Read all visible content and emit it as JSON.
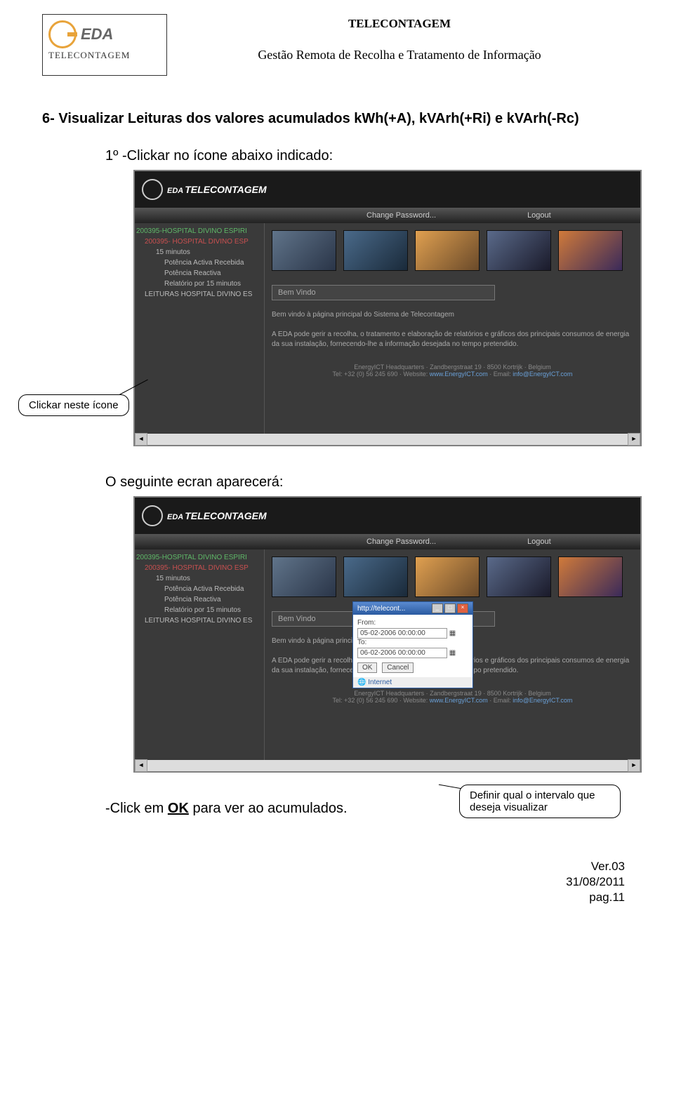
{
  "header": {
    "brand_name": "EDA",
    "brand_sub": "TELECONTAGEM",
    "line1": "TELECONTAGEM",
    "line2": "Gestão Remota de Recolha e Tratamento de Informação"
  },
  "section_title": "6- Visualizar Leituras dos valores acumulados kWh(+A), kVArh(+Ri) e kVArh(-Rc)",
  "step1": "1º -Clickar no ícone abaixo indicado:",
  "callout1": "Clickar neste ícone",
  "screenshot": {
    "brand": "TELECONTAGEM",
    "menu": {
      "change_pw": "Change Password...",
      "logout": "Logout"
    },
    "tree": [
      {
        "cls": "ti1",
        "t": "200395-HOSPITAL DIVINO ESPIRI"
      },
      {
        "cls": "ti2",
        "t": "200395- HOSPITAL DIVINO ESP"
      },
      {
        "cls": "ti3",
        "t": "15 minutos"
      },
      {
        "cls": "ti4",
        "t": "Potência Activa  Recebida"
      },
      {
        "cls": "ti4",
        "t": "Potência Reactiva"
      },
      {
        "cls": "ti4",
        "t": "Relatório por 15 minutos"
      },
      {
        "cls": "ti5",
        "t": "LEITURAS HOSPITAL DIVINO ES"
      }
    ],
    "bemvindo": "Bem Vindo",
    "welcome_line": "Bem vindo à página principal do Sistema de Telecontagem",
    "desc": "A EDA pode gerir a recolha, o tratamento e elaboração de relatórios e gráficos dos principais consumos de energia da sua instalação, fornecendo-lhe a informação desejada no tempo pretendido.",
    "foot1": "EnergyICT Headquarters · Zandbergstraat 19 · 8500 Kortrijk · Belgium",
    "foot2a": "Tel: +32 (0) 56 245 690 · Website: ",
    "foot_link1": "www.EnergyICT.com",
    "foot2b": " · Email: ",
    "foot_link2": "info@EnergyICT.com"
  },
  "step2": "O seguinte ecran aparecerá:",
  "popup": {
    "title": "http://telecont...",
    "from_label": "From:",
    "from_value": "05-02-2006 00:00:00",
    "to_label": "To:",
    "to_value": "06-02-2006 00:00:00",
    "ok": "OK",
    "cancel": "Cancel",
    "status": "Internet"
  },
  "callout2": "Definir qual o intervalo que deseja visualizar",
  "screenshot2_tree": [
    {
      "cls": "ti1",
      "t": "200395-HOSPITAL DIVINO ESPIRI"
    },
    {
      "cls": "ti2",
      "t": "200395- HOSPITAL DIVINO ESP"
    },
    {
      "cls": "ti3",
      "t": "15 minutos"
    },
    {
      "cls": "ti4",
      "t": "Potência Activa  Recebida"
    },
    {
      "cls": "ti4",
      "t": "Potência Reactiva"
    },
    {
      "cls": "ti4",
      "t": "Relatório por 15 minutos"
    },
    {
      "cls": "ti5",
      "t": "LEITURAS HOSPITAL DIVINO ES"
    }
  ],
  "final_a": "-Click em ",
  "final_ok": "OK",
  "final_b": " para ver ao acumulados.",
  "footer": {
    "ver": "Ver.03",
    "date": "31/08/2011",
    "page": "pag.11"
  }
}
